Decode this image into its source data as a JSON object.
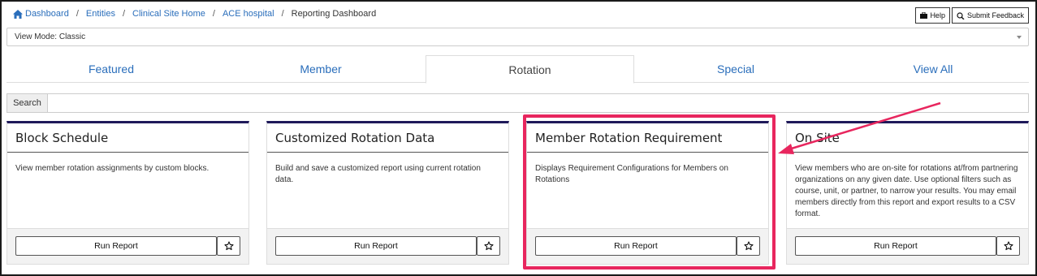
{
  "breadcrumb": {
    "items": [
      "Dashboard",
      "Entities",
      "Clinical Site Home",
      "ACE hospital"
    ],
    "current": "Reporting Dashboard",
    "separator": "/"
  },
  "header_buttons": {
    "help": "Help",
    "feedback": "Submit Feedback"
  },
  "view_mode": {
    "value": "View Mode: Classic"
  },
  "tabs": [
    {
      "label": "Featured"
    },
    {
      "label": "Member"
    },
    {
      "label": "Rotation"
    },
    {
      "label": "Special"
    },
    {
      "label": "View All"
    }
  ],
  "active_tab": "Rotation",
  "search": {
    "label": "Search",
    "value": ""
  },
  "cards": [
    {
      "title": "Block Schedule",
      "description": "View member rotation assignments by custom blocks.",
      "button": "Run Report"
    },
    {
      "title": "Customized Rotation Data",
      "description": "Build and save a customized report using current rotation data.",
      "button": "Run Report"
    },
    {
      "title": "Member Rotation Requirement",
      "description": "Displays Requirement Configurations for Members on Rotations",
      "button": "Run Report"
    },
    {
      "title": "On Site",
      "description": "View members who are on-site for rotations at/from partnering organizations on any given date. Use optional filters such as course, unit, or partner, to narrow your results. You may email members directly from this report and export results to a CSV format.",
      "button": "Run Report"
    }
  ],
  "colors": {
    "link": "#2a6ebb",
    "card_top_border": "#1f1a5a",
    "highlight": "#e8265e"
  },
  "icons": [
    "home-icon",
    "briefcase-icon",
    "feedback-icon",
    "star-icon",
    "chevron-down-icon",
    "arrow-annotation"
  ]
}
